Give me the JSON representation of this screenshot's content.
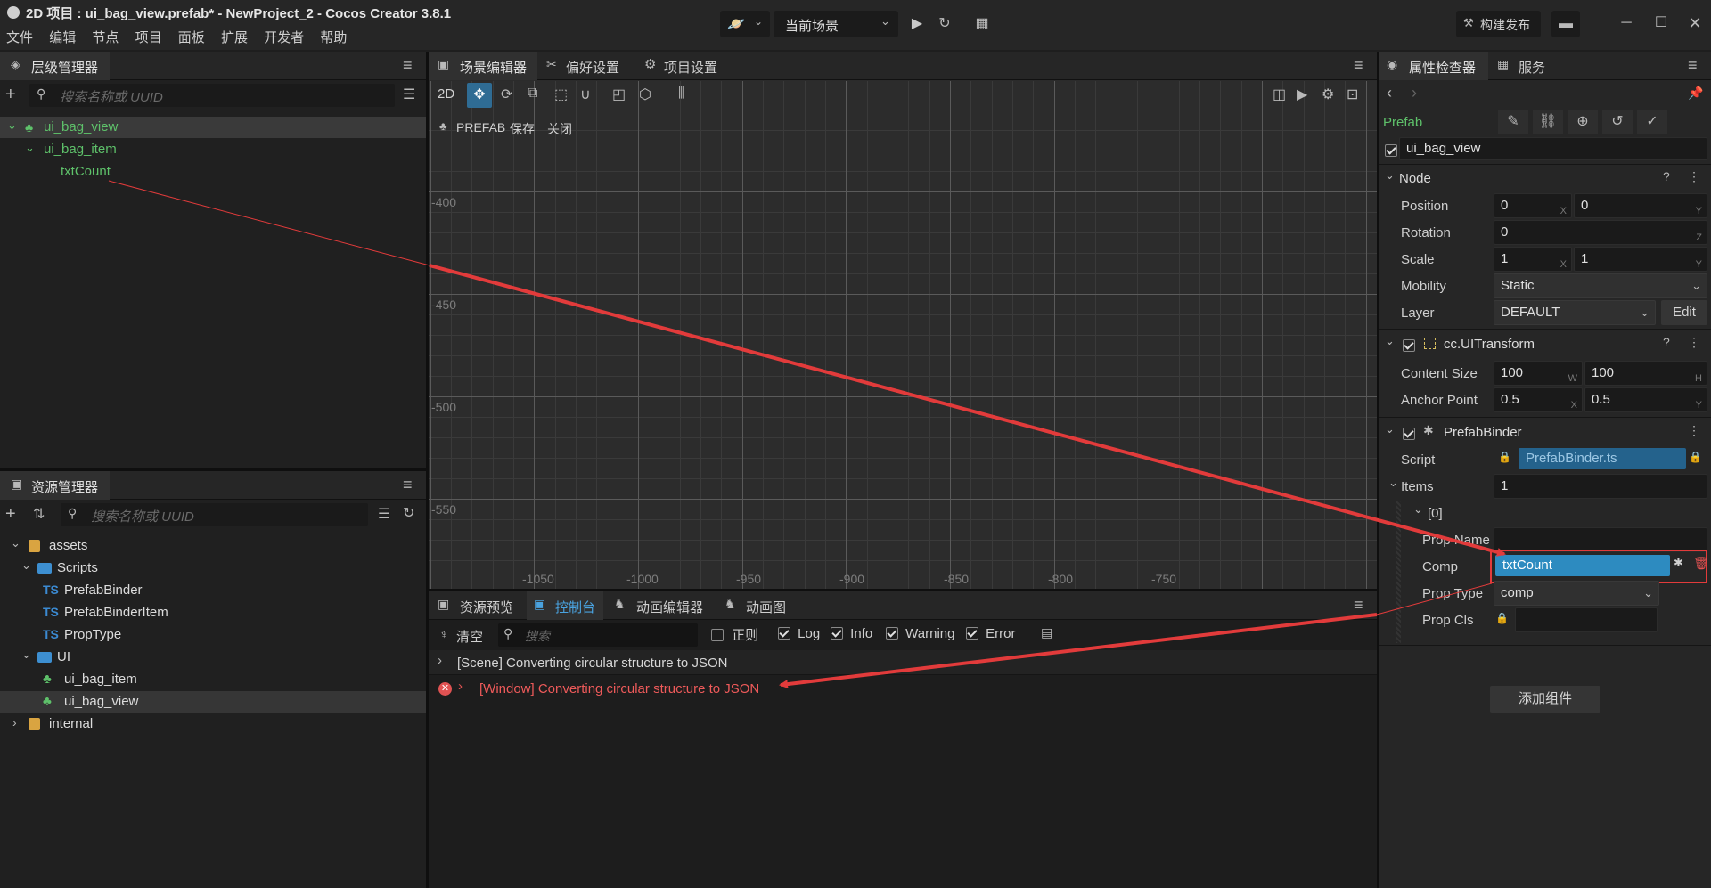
{
  "window": {
    "title": "2D 项目 : ui_bag_view.prefab* - NewProject_2 - Cocos Creator 3.8.1",
    "menu": [
      "文件",
      "编辑",
      "节点",
      "项目",
      "面板",
      "扩展",
      "开发者",
      "帮助"
    ],
    "scene_select": "当前场景",
    "build_button": "构建发布"
  },
  "hierarchy": {
    "tab": "层级管理器",
    "search_placeholder": "搜索名称或 UUID",
    "nodes": [
      {
        "label": "ui_bag_view",
        "level": 0
      },
      {
        "label": "ui_bag_item",
        "level": 1
      },
      {
        "label": "txtCount",
        "level": 2
      }
    ]
  },
  "assets": {
    "tab": "资源管理器",
    "search_placeholder": "搜索名称或 UUID",
    "tree": {
      "assets": "assets",
      "scripts": "Scripts",
      "ts_badge": "TS",
      "script_files": [
        "PrefabBinder",
        "PrefabBinderItem",
        "PropType"
      ],
      "ui": "UI",
      "ui_files": [
        "ui_bag_item",
        "ui_bag_view"
      ],
      "internal": "internal"
    }
  },
  "scene": {
    "tabs": [
      "场景编辑器",
      "偏好设置",
      "项目设置"
    ],
    "mode_2d": "2D",
    "prefab_label": "PREFAB",
    "save": "保存",
    "close": "关闭",
    "y_labels": [
      "-400",
      "-450",
      "-500",
      "-550"
    ],
    "x_labels": [
      "-1050",
      "-1000",
      "-950",
      "-900",
      "-850",
      "-800",
      "-750"
    ]
  },
  "console": {
    "tabs": [
      "资源预览",
      "控制台",
      "动画编辑器",
      "动画图"
    ],
    "clear": "清空",
    "search_placeholder": "搜索",
    "regex": "正则",
    "filters": [
      "Log",
      "Info",
      "Warning",
      "Error"
    ],
    "messages": [
      {
        "text": "[Scene] Converting circular structure to JSON",
        "level": "log"
      },
      {
        "text": "[Window] Converting circular structure to JSON",
        "level": "error"
      }
    ]
  },
  "inspector": {
    "tabs": [
      "属性检查器",
      "服务"
    ],
    "prefab_label": "Prefab",
    "node_name": "ui_bag_view",
    "node_section": "Node",
    "position": {
      "label": "Position",
      "x": "0",
      "y": "0"
    },
    "rotation": {
      "label": "Rotation",
      "z": "0"
    },
    "scale": {
      "label": "Scale",
      "x": "1",
      "y": "1"
    },
    "mobility": {
      "label": "Mobility",
      "value": "Static"
    },
    "layer": {
      "label": "Layer",
      "value": "DEFAULT",
      "edit": "Edit"
    },
    "uitransform": {
      "title": "cc.UITransform",
      "content_size": {
        "label": "Content Size",
        "w": "100",
        "h": "100"
      },
      "anchor": {
        "label": "Anchor Point",
        "x": "0.5",
        "y": "0.5"
      }
    },
    "binder": {
      "title": "PrefabBinder",
      "script_label": "Script",
      "script_value": "PrefabBinder.ts",
      "items_label": "Items",
      "items_count": "1",
      "item_index": "[0]",
      "prop_name_label": "Prop Name",
      "prop_name_value": "",
      "comp_label": "Comp",
      "comp_value": "txtCount",
      "prop_type_label": "Prop Type",
      "prop_type_value": "comp",
      "prop_cls_label": "Prop Cls",
      "prop_cls_value": ""
    },
    "add_component": "添加组件"
  },
  "units": {
    "x": "X",
    "y": "Y",
    "z": "Z",
    "w": "W",
    "h": "H"
  },
  "colors": {
    "accent": "#2f8fc7",
    "green": "#5ec16a",
    "error": "#e05252",
    "annotation": "#e23b3b"
  }
}
